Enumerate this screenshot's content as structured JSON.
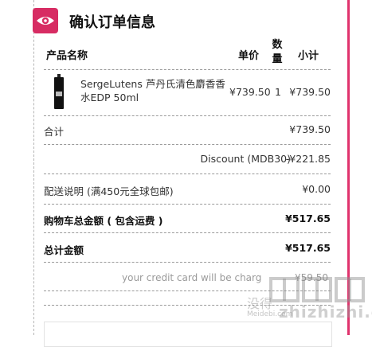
{
  "header": {
    "title": "确认订单信息",
    "icon": "eye-icon",
    "accent_color": "#d72c63"
  },
  "columns": {
    "product": "产品名称",
    "price": "单价",
    "qty": "数量",
    "subtotal": "小计"
  },
  "product": {
    "name": "SergeLutens 芦丹氏清色麝香香水EDP 50ml",
    "price": "¥739.50",
    "qty": "1",
    "subtotal": "¥739.50"
  },
  "summary": {
    "total_label": "合计",
    "total_value": "¥739.50",
    "discount_label": "Discount (MDB30)",
    "discount_value": "-¥221.85",
    "shipping_label": "配送说明 (满450元全球包邮)",
    "shipping_value": "¥0.00",
    "cart_total_label": "购物车总金额 ( 包含运费 )",
    "cart_total_value": "¥517.65",
    "grand_total_label": "总计金额",
    "grand_total_value": "¥517.65"
  },
  "credit_note": {
    "text": "your credit card will be charg",
    "value": "¥59.50"
  },
  "watermark": {
    "cn": "没得",
    "en": "Meidebi.com",
    "site": "zhizhizhi.com"
  },
  "colors": {
    "accent": "#e0336d"
  }
}
